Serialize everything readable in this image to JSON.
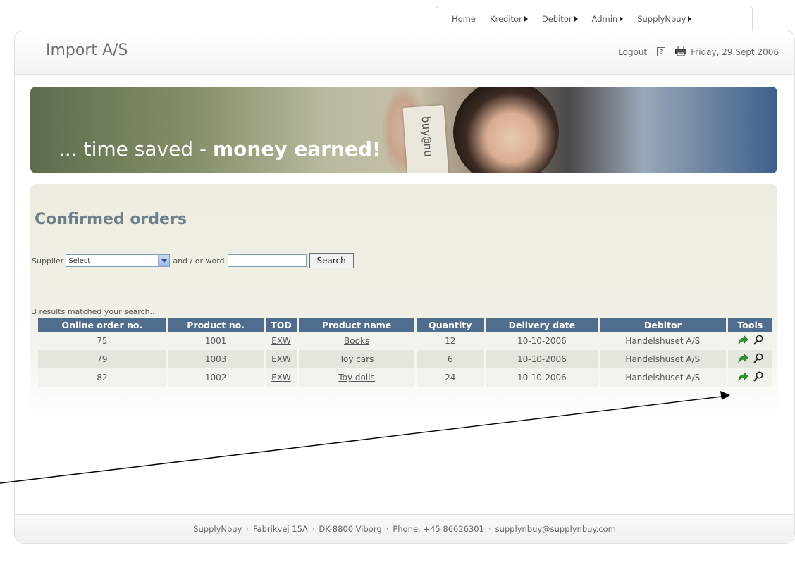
{
  "nav": {
    "items": [
      {
        "label": "Home",
        "has_submenu": false
      },
      {
        "label": "Kreditor",
        "has_submenu": true
      },
      {
        "label": "Debitor",
        "has_submenu": true
      },
      {
        "label": "Admin",
        "has_submenu": true
      },
      {
        "label": "SupplyNbuy",
        "has_submenu": true
      }
    ]
  },
  "header": {
    "company": "Import A/S",
    "logout": "Logout",
    "help_glyph": "?",
    "date": "Friday, 29.Sept.2006"
  },
  "banner": {
    "text_regular": "... time saved - ",
    "text_bold": "money earned!",
    "card_logo": "buy@nu"
  },
  "page": {
    "title": "Confirmed orders"
  },
  "search": {
    "supplier_label": "Supplier",
    "supplier_selected": "Select",
    "word_label": "and / or word",
    "word_value": "",
    "button_label": "Search"
  },
  "results": {
    "summary": "3 results matched your search...",
    "columns": [
      "Online order no.",
      "Product no.",
      "TOD",
      "Product name",
      "Quantity",
      "Delivery date",
      "Debitor",
      "Tools"
    ],
    "rows": [
      {
        "order_no": "75",
        "product_no": "1001",
        "tod": "EXW",
        "product_name": "Books",
        "quantity": "12",
        "delivery_date": "10-10-2006",
        "debitor": "Handelshuset A/S"
      },
      {
        "order_no": "79",
        "product_no": "1003",
        "tod": "EXW",
        "product_name": "Toy cars",
        "quantity": "6",
        "delivery_date": "10-10-2006",
        "debitor": "Handelshuset A/S"
      },
      {
        "order_no": "82",
        "product_no": "1002",
        "tod": "EXW",
        "product_name": "Toy dolls",
        "quantity": "24",
        "delivery_date": "10-10-2006",
        "debitor": "Handelshuset A/S"
      }
    ]
  },
  "footer": {
    "parts": [
      "SupplyNbuy",
      "Fabrikvej 15A",
      "DK-8800 Viborg",
      "Phone: +45 86626301",
      "supplynbuy@supplynbuy.com"
    ],
    "separator": "·"
  },
  "colors": {
    "table_header": "#4f6d8c",
    "title": "#6e7f8c",
    "forward_icon": "#2e9b2e"
  },
  "icons": [
    "arrow-right-icon",
    "help-icon",
    "printer-icon",
    "select-arrow-icon",
    "forward-icon",
    "magnifier-icon"
  ]
}
